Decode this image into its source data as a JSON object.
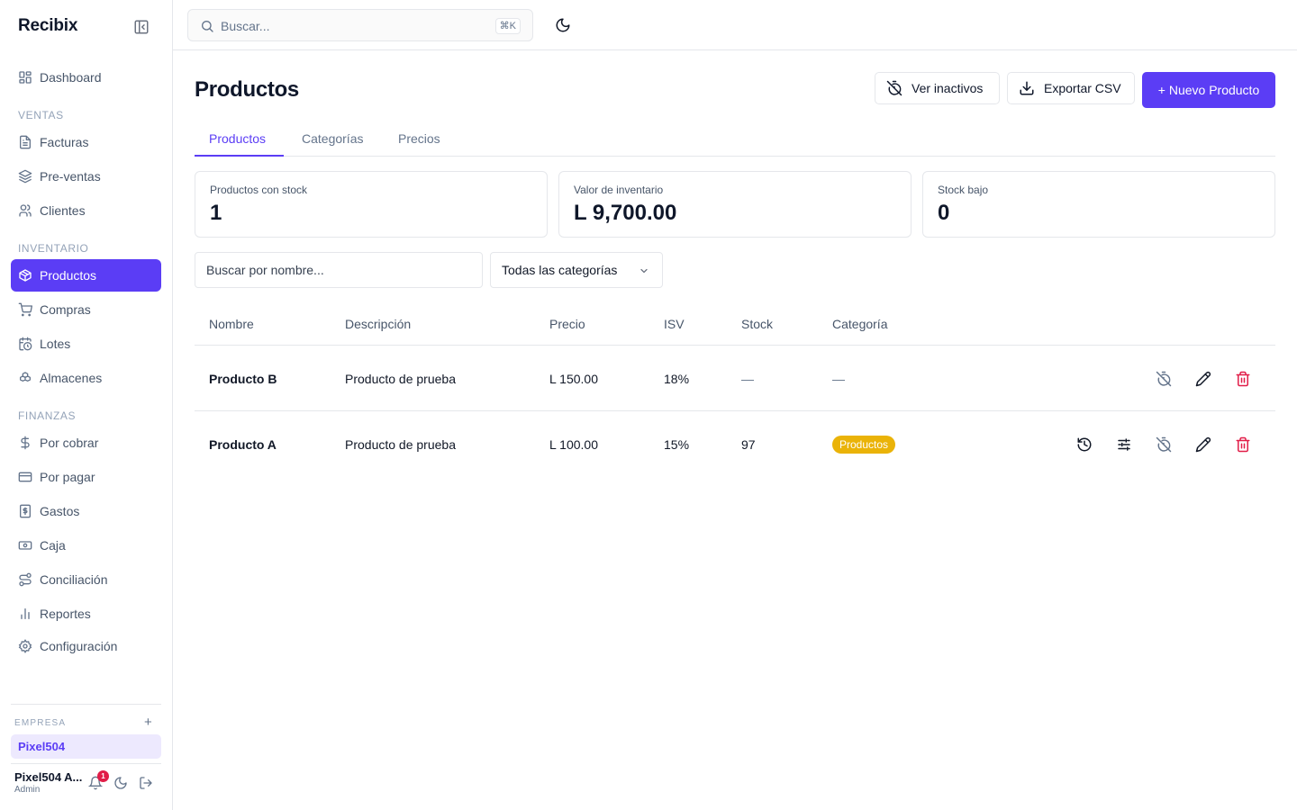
{
  "app": {
    "brand": "Recibix"
  },
  "sidebar": {
    "items": [
      {
        "label": "Dashboard",
        "icon": "dashboard-icon"
      },
      {
        "label": "Facturas",
        "icon": "file-text-icon"
      },
      {
        "label": "Pre-ventas",
        "icon": "layers-icon"
      },
      {
        "label": "Clientes",
        "icon": "users-icon"
      },
      {
        "label": "Productos",
        "icon": "package-icon",
        "active": true
      },
      {
        "label": "Compras",
        "icon": "cart-icon"
      },
      {
        "label": "Lotes",
        "icon": "calendar-clock-icon"
      },
      {
        "label": "Almacenes",
        "icon": "boxes-icon"
      },
      {
        "label": "Por cobrar",
        "icon": "dollar-icon"
      },
      {
        "label": "Por pagar",
        "icon": "credit-card-icon"
      },
      {
        "label": "Gastos",
        "icon": "receipt-icon"
      },
      {
        "label": "Caja",
        "icon": "banknote-icon"
      },
      {
        "label": "Conciliación",
        "icon": "route-icon"
      },
      {
        "label": "Reportes",
        "icon": "bar-chart-icon"
      },
      {
        "label": "Configuración",
        "icon": "gear-icon"
      }
    ],
    "sections": {
      "ventas": "VENTAS",
      "inventario": "INVENTARIO",
      "finanzas": "FINANZAS"
    },
    "empresa": {
      "label": "EMPRESA",
      "add": "+",
      "current": "Pixel504"
    },
    "user": {
      "name": "Pixel504 A...",
      "role": "Admin",
      "notifications": "1"
    }
  },
  "topbar": {
    "search_placeholder": "Buscar...",
    "shortcut": "⌘K"
  },
  "page": {
    "title": "Productos",
    "buttons": {
      "inactive": "Ver inactivos",
      "export": "Exportar CSV",
      "new": "+ Nuevo Producto"
    },
    "tabs": [
      "Productos",
      "Categorías",
      "Precios"
    ],
    "stats": [
      {
        "label": "Productos con stock",
        "value": "1"
      },
      {
        "label": "Valor de inventario",
        "value": "L 9,700.00"
      },
      {
        "label": "Stock bajo",
        "value": "0"
      }
    ],
    "filters": {
      "name_placeholder": "Buscar por nombre...",
      "category": "Todas las categorías"
    },
    "table": {
      "headers": [
        "Nombre",
        "Descripción",
        "Precio",
        "ISV",
        "Stock",
        "Categoría"
      ],
      "rows": [
        {
          "name": "Producto B",
          "description": "Producto de prueba",
          "price": "L 150.00",
          "isv": "18%",
          "stock": "—",
          "category": "—"
        },
        {
          "name": "Producto A",
          "description": "Producto de prueba",
          "price": "L 100.00",
          "isv": "15%",
          "stock": "97",
          "category": "Productos"
        }
      ]
    }
  },
  "colors": {
    "accent": "#5b3df5",
    "danger": "#e11d48",
    "category_pill": "#eab308"
  }
}
